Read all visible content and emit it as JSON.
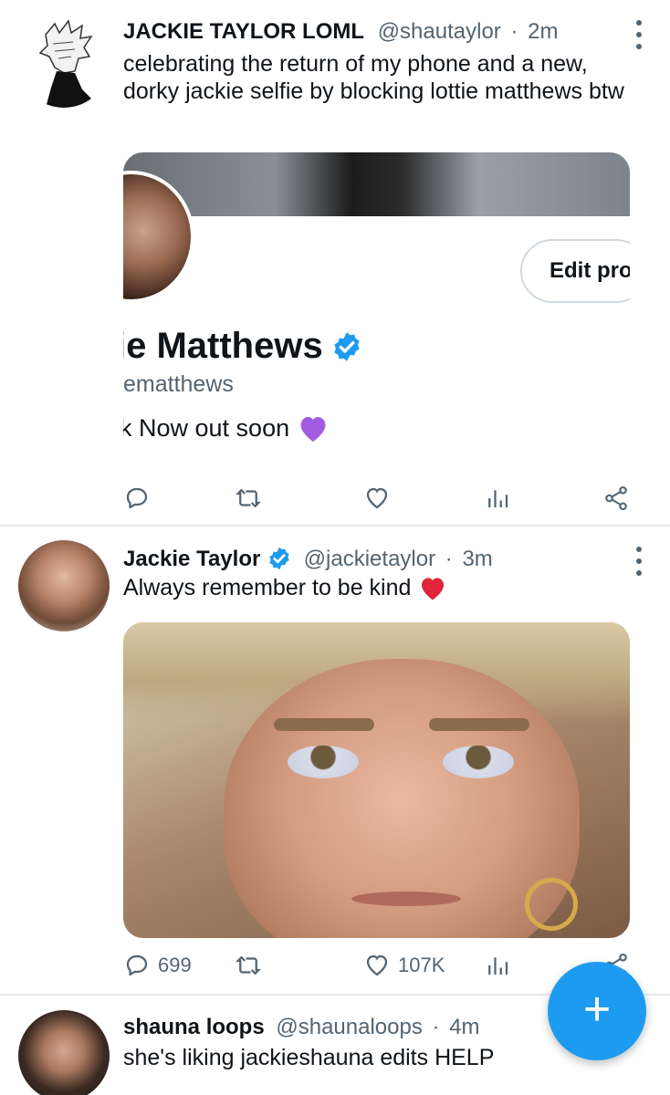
{
  "feed": {
    "tweets": [
      {
        "display_name": "JACKIE TAYLOR LOML",
        "handle": "@shautaylor",
        "separator": "·",
        "time": "2m",
        "text": "celebrating the return of my phone and a new, dorky jackie selfie by blocking lottie matthews btw",
        "media": {
          "edit_label": "Edit pro",
          "profile_name": "ie Matthews",
          "profile_handle": "ematthews",
          "profile_bio": "k Now out soon"
        }
      },
      {
        "display_name": "Jackie Taylor",
        "handle": "@jackietaylor",
        "separator": "·",
        "time": "3m",
        "text": "Always remember to be kind",
        "reply_count": "699",
        "like_count": "107K"
      },
      {
        "display_name": "shauna loops",
        "handle": "@shaunaloops",
        "separator": "·",
        "time": "4m",
        "text": "she's liking jackieshauna edits HELP"
      }
    ]
  },
  "icons": {
    "reply": "reply-icon",
    "retweet": "retweet-icon",
    "like": "heart-icon",
    "analytics": "analytics-icon",
    "share": "share-icon",
    "more": "more-vertical-icon",
    "verified": "verified-badge-icon",
    "compose": "plus-icon"
  },
  "colors": {
    "accent": "#1d9bf0",
    "text_secondary": "#536471"
  },
  "compose": {
    "glyph": "+"
  }
}
